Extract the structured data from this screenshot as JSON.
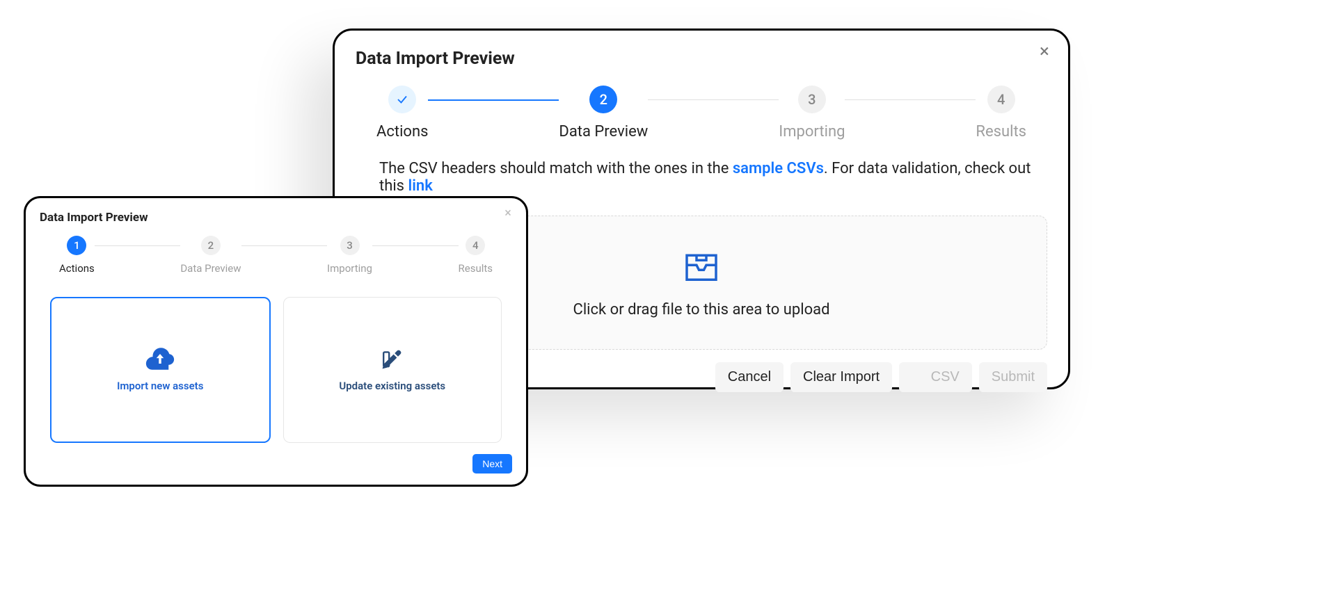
{
  "title": "Data Import Preview",
  "stepper_large": {
    "steps": [
      {
        "num": "✓",
        "label": "Actions"
      },
      {
        "num": "2",
        "label": "Data Preview"
      },
      {
        "num": "3",
        "label": "Importing"
      },
      {
        "num": "4",
        "label": "Results"
      }
    ]
  },
  "hint": {
    "pre": "The CSV headers should match with the ones in the ",
    "link1": "sample CSVs",
    "mid": ". For data validation, check out this ",
    "link2": "link"
  },
  "dropzone_text": "Click or drag file to this area to upload",
  "buttons": {
    "cancel": "Cancel",
    "clear": "Clear Import",
    "csv": "CSV",
    "submit": "Submit"
  },
  "stepper_small": {
    "steps": [
      {
        "num": "1",
        "label": "Actions"
      },
      {
        "num": "2",
        "label": "Data Preview"
      },
      {
        "num": "3",
        "label": "Importing"
      },
      {
        "num": "4",
        "label": "Results"
      }
    ]
  },
  "cards": {
    "import_new": "Import new assets",
    "update_existing": "Update existing assets"
  },
  "next_label": "Next"
}
